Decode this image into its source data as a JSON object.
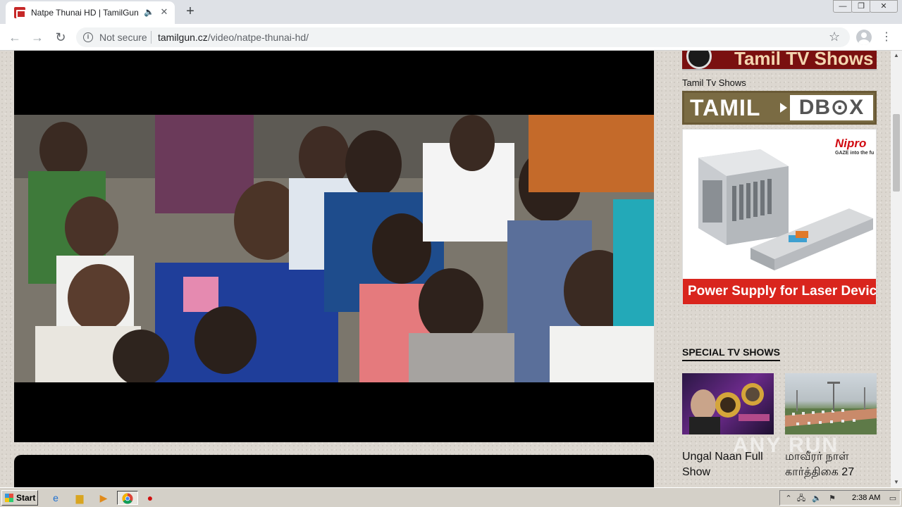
{
  "browser": {
    "tab": {
      "title": "Natpe Thunai HD | TamilGun",
      "audio_icon": "speaker-icon",
      "close_glyph": "✕"
    },
    "new_tab_glyph": "+",
    "window_controls": {
      "minimize": "—",
      "restore": "❐",
      "close": "✕"
    },
    "toolbar": {
      "back_glyph": "←",
      "forward_glyph": "→",
      "reload_glyph": "↻",
      "security_label": "Not secure",
      "url_host": "tamilgun.cz",
      "url_path": "/video/natpe-thunai-hd/",
      "star_glyph": "☆",
      "menu_glyph": "⋮"
    }
  },
  "sidebar": {
    "top_banner_text": "Tamil TV Shows",
    "tv_shows_label": "Tamil Tv Shows",
    "tamil_dbox": {
      "left": "TAMIL",
      "right": "DB⊙X"
    },
    "ad": {
      "brand": "Nipro",
      "tagline": "GAZE into the fu",
      "caption": "Power Supply for Laser Device"
    },
    "special_heading": "SPECIAL TV SHOWS",
    "shows": [
      {
        "title": "Ungal Naan Full Show"
      },
      {
        "title": "மாவீரர் நாள் கார்த்திகை 27"
      }
    ]
  },
  "watermark": "ANY RUN",
  "taskbar": {
    "start_label": "Start",
    "clock": "2:38 AM"
  },
  "colors": {
    "page_bg": "#dcd7d0",
    "ad_red": "#d9251d",
    "tab_strip": "#dee1e6"
  }
}
